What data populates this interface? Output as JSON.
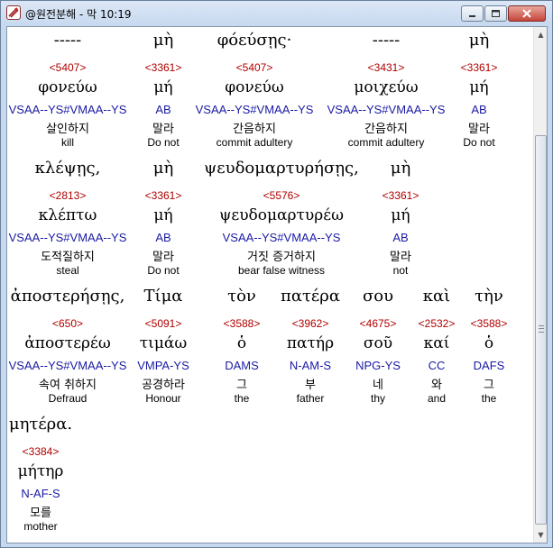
{
  "window": {
    "title": "@원전분해 - 막 10:19"
  },
  "rows": [
    [
      {
        "word": "-----",
        "strong": "<5407>",
        "lemma": "φονεύω",
        "morph": "VSAA--YS#VMAA--YS",
        "korean": "살인하지",
        "english": "kill"
      },
      {
        "word": "μὴ",
        "strong": "<3361>",
        "lemma": "μή",
        "morph": "AB",
        "korean": "말라",
        "english": "Do not"
      },
      {
        "word": "φόεύσῃς·",
        "strong": "<5407>",
        "lemma": "φονεύω",
        "morph": "VSAA--YS#VMAA--YS",
        "korean": "간음하지",
        "english": "commit adultery"
      },
      {
        "word": "-----",
        "strong": "<3431>",
        "lemma": "μοιχεύω",
        "morph": "VSAA--YS#VMAA--YS",
        "korean": "간음하지",
        "english": "commit adultery"
      },
      {
        "word": "μὴ",
        "strong": "<3361>",
        "lemma": "μή",
        "morph": "AB",
        "korean": "말라",
        "english": "Do not"
      }
    ],
    [
      {
        "word": "κλέψῃς,",
        "strong": "<2813>",
        "lemma": "κλέπτω",
        "morph": "VSAA--YS#VMAA--YS",
        "korean": "도적질하지",
        "english": "steal"
      },
      {
        "word": "μὴ",
        "strong": "<3361>",
        "lemma": "μή",
        "morph": "AB",
        "korean": "말라",
        "english": "Do not"
      },
      {
        "word": "ψευδομαρτυρήσῃς,",
        "strong": "<5576>",
        "lemma": "ψευδομαρτυρέω",
        "morph": "VSAA--YS#VMAA--YS",
        "korean": "거짓 증거하지",
        "english": "bear false witness"
      },
      {
        "word": "μὴ",
        "strong": "<3361>",
        "lemma": "μή",
        "morph": "AB",
        "korean": "말라",
        "english": "not"
      }
    ],
    [
      {
        "word": "ἀποστερήσῃς,",
        "strong": "<650>",
        "lemma": "ἀποστερέω",
        "morph": "VSAA--YS#VMAA--YS",
        "korean": "속여 취하지",
        "english": "Defraud"
      },
      {
        "word": "Τίμα",
        "strong": "<5091>",
        "lemma": "τιμάω",
        "morph": "VMPA-YS",
        "korean": "공경하라",
        "english": "Honour"
      },
      {
        "word": "τὸν",
        "strong": "<3588>",
        "lemma": "ὁ",
        "morph": "DAMS",
        "korean": "그",
        "english": "the"
      },
      {
        "word": "πατέρα",
        "strong": "<3962>",
        "lemma": "πατήρ",
        "morph": "N-AM-S",
        "korean": "부",
        "english": "father"
      },
      {
        "word": "σου",
        "strong": "<4675>",
        "lemma": "σοῦ",
        "morph": "NPG-YS",
        "korean": "네",
        "english": "thy"
      },
      {
        "word": "καὶ",
        "strong": "<2532>",
        "lemma": "καί",
        "morph": "CC",
        "korean": "와",
        "english": "and"
      },
      {
        "word": "τὴν",
        "strong": "<3588>",
        "lemma": "ὁ",
        "morph": "DAFS",
        "korean": "그",
        "english": "the"
      }
    ],
    [
      {
        "word": "μητέρα.",
        "strong": "<3384>",
        "lemma": "μήτηρ",
        "morph": "N-AF-S",
        "korean": "모를",
        "english": "mother"
      }
    ]
  ]
}
